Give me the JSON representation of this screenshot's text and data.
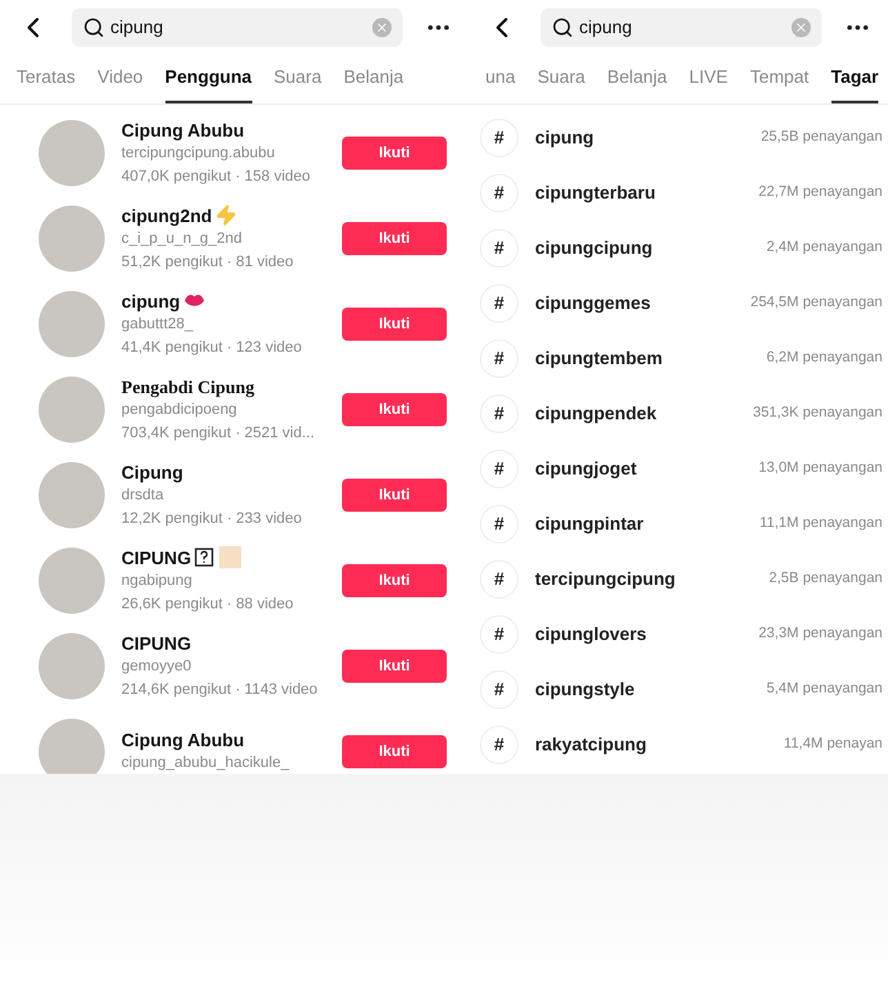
{
  "panels": [
    {
      "search": {
        "value": "cipung"
      },
      "tabs": [
        {
          "label": "Teratas",
          "selected": false
        },
        {
          "label": "Video",
          "selected": false
        },
        {
          "label": "Pengguna",
          "selected": true
        },
        {
          "label": "Suara",
          "selected": false
        },
        {
          "label": "Belanja",
          "selected": false
        }
      ],
      "kind": "users",
      "users": [
        {
          "name": "Cipung Abubu",
          "handle": "tercipungcipung.abubu",
          "stats": "407,0K pengikut · 158 video",
          "button": "Ikuti",
          "kind": "plain",
          "serif": false
        },
        {
          "name": "cipung2nd",
          "handle": "c_i_p_u_n_g_2nd",
          "stats": "51,2K pengikut · 81 video",
          "button": "Ikuti",
          "kind": "bolt",
          "serif": false
        },
        {
          "name": "cipung",
          "handle": "gabuttt28_",
          "stats": "41,4K pengikut · 123 video",
          "button": "Ikuti",
          "kind": "lips",
          "serif": false
        },
        {
          "name": "Pengabdi Cipung",
          "handle": "pengabdicipoeng",
          "stats": "703,4K pengikut · 2521 vid...",
          "button": "Ikuti",
          "kind": "plain",
          "serif": true
        },
        {
          "name": "Cipung",
          "handle": "drsdta",
          "stats": "12,2K pengikut · 233 video",
          "button": "Ikuti",
          "kind": "plain",
          "serif": false
        },
        {
          "name": "CIPUNG",
          "handle": "ngabipung",
          "stats": "26,6K pengikut · 88 video",
          "button": "Ikuti",
          "kind": "unknown",
          "serif": false
        },
        {
          "name": "CIPUNG",
          "handle": "gemoyye0",
          "stats": "214,6K pengikut · 1143 video",
          "button": "Ikuti",
          "kind": "plain",
          "serif": false
        },
        {
          "name": "Cipung Abubu",
          "handle": "cipung_abubu_hacikule_",
          "button": "Ikuti",
          "kind": "plain",
          "serif": false
        }
      ]
    },
    {
      "search": {
        "value": "cipung"
      },
      "tabs": [
        {
          "label": "una",
          "selected": false
        },
        {
          "label": "Suara",
          "selected": false
        },
        {
          "label": "Belanja",
          "selected": false
        },
        {
          "label": "LIVE",
          "selected": false
        },
        {
          "label": "Tempat",
          "selected": false
        },
        {
          "label": "Tagar",
          "selected": true
        }
      ],
      "kind": "hashtags",
      "hashtags": [
        {
          "symbol": "#",
          "tag": "cipung",
          "views": "25,5B penayangan"
        },
        {
          "symbol": "#",
          "tag": "cipungterbaru",
          "views": "22,7M penayangan"
        },
        {
          "symbol": "#",
          "tag": "cipungcipung",
          "views": "2,4M penayangan"
        },
        {
          "symbol": "#",
          "tag": "cipunggemes",
          "views": "254,5M penayangan"
        },
        {
          "symbol": "#",
          "tag": "cipungtembem",
          "views": "6,2M penayangan"
        },
        {
          "symbol": "#",
          "tag": "cipungpendek",
          "views": "351,3K penayangan"
        },
        {
          "symbol": "#",
          "tag": "cipungjoget",
          "views": "13,0M penayangan"
        },
        {
          "symbol": "#",
          "tag": "cipungpintar",
          "views": "11,1M penayangan"
        },
        {
          "symbol": "#",
          "tag": "tercipungcipung",
          "views": "2,5B penayangan"
        },
        {
          "symbol": "#",
          "tag": "cipunglovers",
          "views": "23,3M penayangan"
        },
        {
          "symbol": "#",
          "tag": "cipungstyle",
          "views": "5,4M penayangan"
        },
        {
          "symbol": "#",
          "tag": "rakyatcipung",
          "views": "11,4M penayan"
        }
      ]
    }
  ]
}
